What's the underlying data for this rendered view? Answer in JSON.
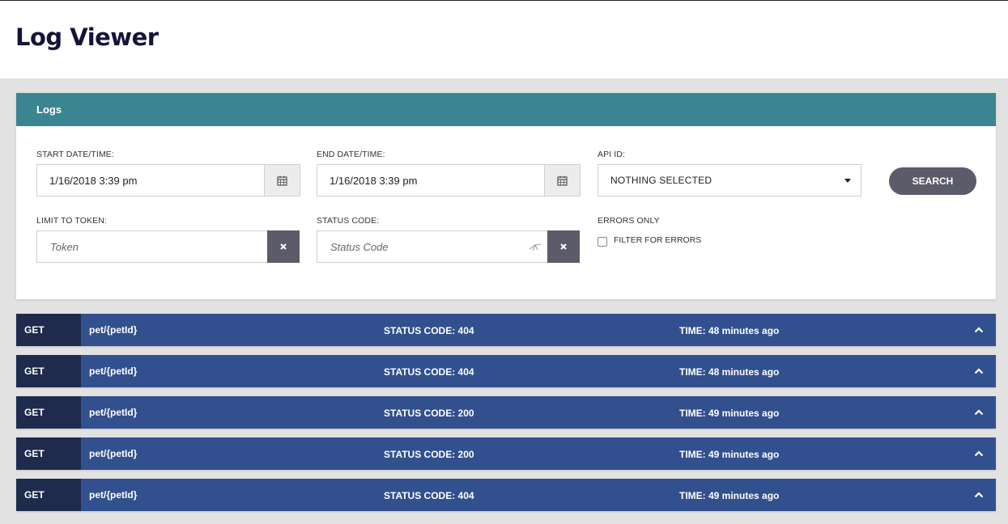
{
  "page": {
    "title": "Log Viewer"
  },
  "panel": {
    "title": "Logs"
  },
  "filters": {
    "start": {
      "label": "START DATE/TIME:",
      "value": "1/16/2018 3:39 pm",
      "icon": "calendar-icon"
    },
    "end": {
      "label": "END DATE/TIME:",
      "value": "1/16/2018 3:39 pm",
      "icon": "calendar-icon"
    },
    "api": {
      "label": "API ID:",
      "selected": "NOTHING SELECTED"
    },
    "search_label": "SEARCH",
    "token": {
      "label": "LIMIT TO TOKEN:",
      "placeholder": "Token",
      "clear_icon": "close-icon"
    },
    "status": {
      "label": "STATUS CODE:",
      "placeholder": "Status Code",
      "clear_icon": "close-icon"
    },
    "errors": {
      "label": "ERRORS ONLY",
      "checkbox_label": "FILTER FOR ERRORS",
      "checked": false
    }
  },
  "logs": [
    {
      "method": "GET",
      "path": "pet/{petId}",
      "status": "STATUS CODE: 404",
      "time": "TIME: 48 minutes ago"
    },
    {
      "method": "GET",
      "path": "pet/{petId}",
      "status": "STATUS CODE: 404",
      "time": "TIME: 48 minutes ago"
    },
    {
      "method": "GET",
      "path": "pet/{petId}",
      "status": "STATUS CODE: 200",
      "time": "TIME: 49 minutes ago"
    },
    {
      "method": "GET",
      "path": "pet/{petId}",
      "status": "STATUS CODE: 200",
      "time": "TIME: 49 minutes ago"
    },
    {
      "method": "GET",
      "path": "pet/{petId}",
      "status": "STATUS CODE: 404",
      "time": "TIME: 49 minutes ago"
    }
  ],
  "colors": {
    "panel_header": "#3a8591",
    "log_row": "#32508e",
    "log_method": "#1f2b4c",
    "button": "#5b5b69"
  }
}
